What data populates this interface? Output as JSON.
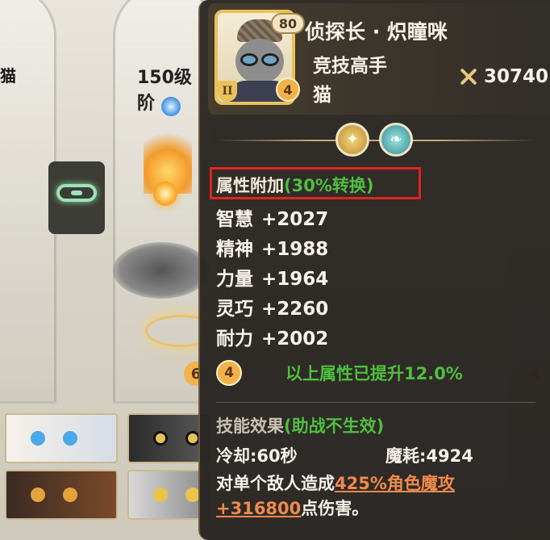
{
  "background": {
    "left_label": "猫",
    "level_text": "150级 阶",
    "left_badge": "6",
    "right_badge": "4"
  },
  "hero": {
    "level": "80",
    "rank": "II",
    "stars": "4",
    "name": "侦探长 · 炽瞳咪",
    "title": "竞技高手",
    "race": "猫",
    "power": "30740"
  },
  "attributes": {
    "title": "属性附加",
    "conversion": "(30%转换)",
    "stats": [
      {
        "label": "智慧",
        "value": "+2027"
      },
      {
        "label": "精神",
        "value": "+1988"
      },
      {
        "label": "力量",
        "value": "+1964"
      },
      {
        "label": "灵巧",
        "value": "+2260"
      },
      {
        "label": "耐力",
        "value": "+2002"
      }
    ],
    "bonus_badge": "4",
    "bonus_text": "以上属性已提升12.0%"
  },
  "skill": {
    "title": "技能效果",
    "note": "(助战不生效)",
    "cooldown": "冷却:60秒",
    "mana": "魔耗:4924",
    "desc_prefix": "对单个敌人造成",
    "desc_highlight": "425%角色魔攻+316800",
    "desc_suffix": "点伤害。"
  },
  "colors": {
    "panel_bg": "#2c2824",
    "accent_green": "#4fbf3f",
    "highlight_orange": "#f08a4b",
    "box_red": "#e0251b",
    "gold": "#e8c15a"
  }
}
